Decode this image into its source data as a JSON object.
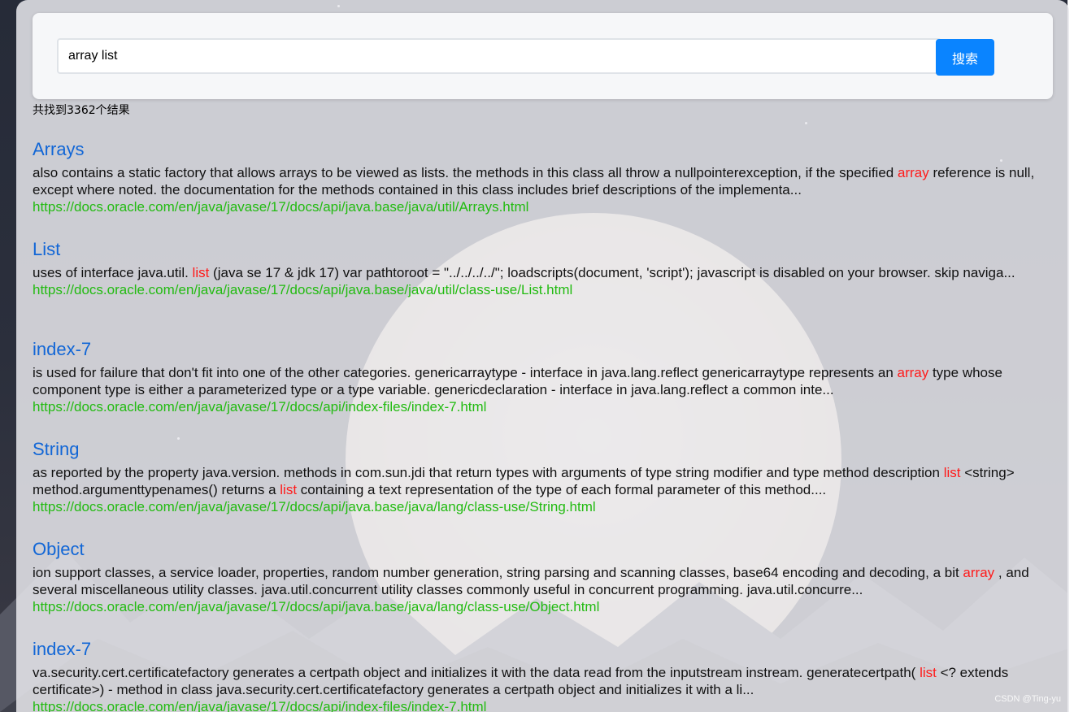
{
  "search": {
    "query": "array list",
    "button_label": "搜索"
  },
  "result_count_text": "共找到3362个结果",
  "results": [
    {
      "title": "Arrays",
      "desc_parts": [
        {
          "text": "also contains a static factory that allows arrays to be viewed as lists. the methods in this class all throw a nullpointerexception, if the specified ",
          "hl": false
        },
        {
          "text": "array",
          "hl": true
        },
        {
          "text": " reference is null, except where noted. the documentation for the methods contained in this class includes brief descriptions of the implementa...",
          "hl": false
        }
      ],
      "url": "https://docs.oracle.com/en/java/javase/17/docs/api/java.base/java/util/Arrays.html"
    },
    {
      "title": "List",
      "desc_parts": [
        {
          "text": "uses of interface java.util. ",
          "hl": false
        },
        {
          "text": "list",
          "hl": true
        },
        {
          "text": " (java se 17 & jdk 17) var pathtoroot = \"../../../../\"; loadscripts(document, 'script'); javascript is disabled on your browser. skip naviga...",
          "hl": false
        }
      ],
      "url": "https://docs.oracle.com/en/java/javase/17/docs/api/java.base/java/util/class-use/List.html"
    },
    {
      "title": "index-7",
      "desc_parts": [
        {
          "text": "is used for failure that don't fit into one of the other categories. genericarraytype - interface in java.lang.reflect genericarraytype represents an ",
          "hl": false
        },
        {
          "text": "array",
          "hl": true
        },
        {
          "text": " type whose component type is either a parameterized type or a type variable. genericdeclaration - interface in java.lang.reflect a common inte...",
          "hl": false
        }
      ],
      "url": "https://docs.oracle.com/en/java/javase/17/docs/api/index-files/index-7.html"
    },
    {
      "title": "String",
      "desc_parts": [
        {
          "text": "as reported by the property java.version. methods in com.sun.jdi that return types with arguments of type string modifier and type method description ",
          "hl": false
        },
        {
          "text": "list",
          "hl": true
        },
        {
          "text": " <string> method.argumenttypenames() returns a ",
          "hl": false
        },
        {
          "text": "list",
          "hl": true
        },
        {
          "text": " containing a text representation of the type of each formal parameter of this method....",
          "hl": false
        }
      ],
      "url": "https://docs.oracle.com/en/java/javase/17/docs/api/java.base/java/lang/class-use/String.html"
    },
    {
      "title": "Object",
      "desc_parts": [
        {
          "text": "ion support classes, a service loader, properties, random number generation, string parsing and scanning classes, base64 encoding and decoding, a bit ",
          "hl": false
        },
        {
          "text": "array",
          "hl": true
        },
        {
          "text": " , and several miscellaneous utility classes. java.util.concurrent utility classes commonly useful in concurrent programming. java.util.concurre...",
          "hl": false
        }
      ],
      "url": "https://docs.oracle.com/en/java/javase/17/docs/api/java.base/java/lang/class-use/Object.html"
    },
    {
      "title": "index-7",
      "desc_parts": [
        {
          "text": "va.security.cert.certificatefactory generates a certpath object and initializes it with the data read from the inputstream instream. generatecertpath( ",
          "hl": false
        },
        {
          "text": "list",
          "hl": true
        },
        {
          "text": " <? extends certificate>) - method in class java.security.cert.certificatefactory generates a certpath object and initializes it with a li...",
          "hl": false
        }
      ],
      "url": "https://docs.oracle.com/en/java/javase/17/docs/api/index-files/index-7.html"
    }
  ],
  "watermark": "CSDN @Ting-yu",
  "colors": {
    "accent": "#0a84ff",
    "title_link": "#1166d6",
    "highlight": "#ff1a1a",
    "url": "#22bb11"
  }
}
